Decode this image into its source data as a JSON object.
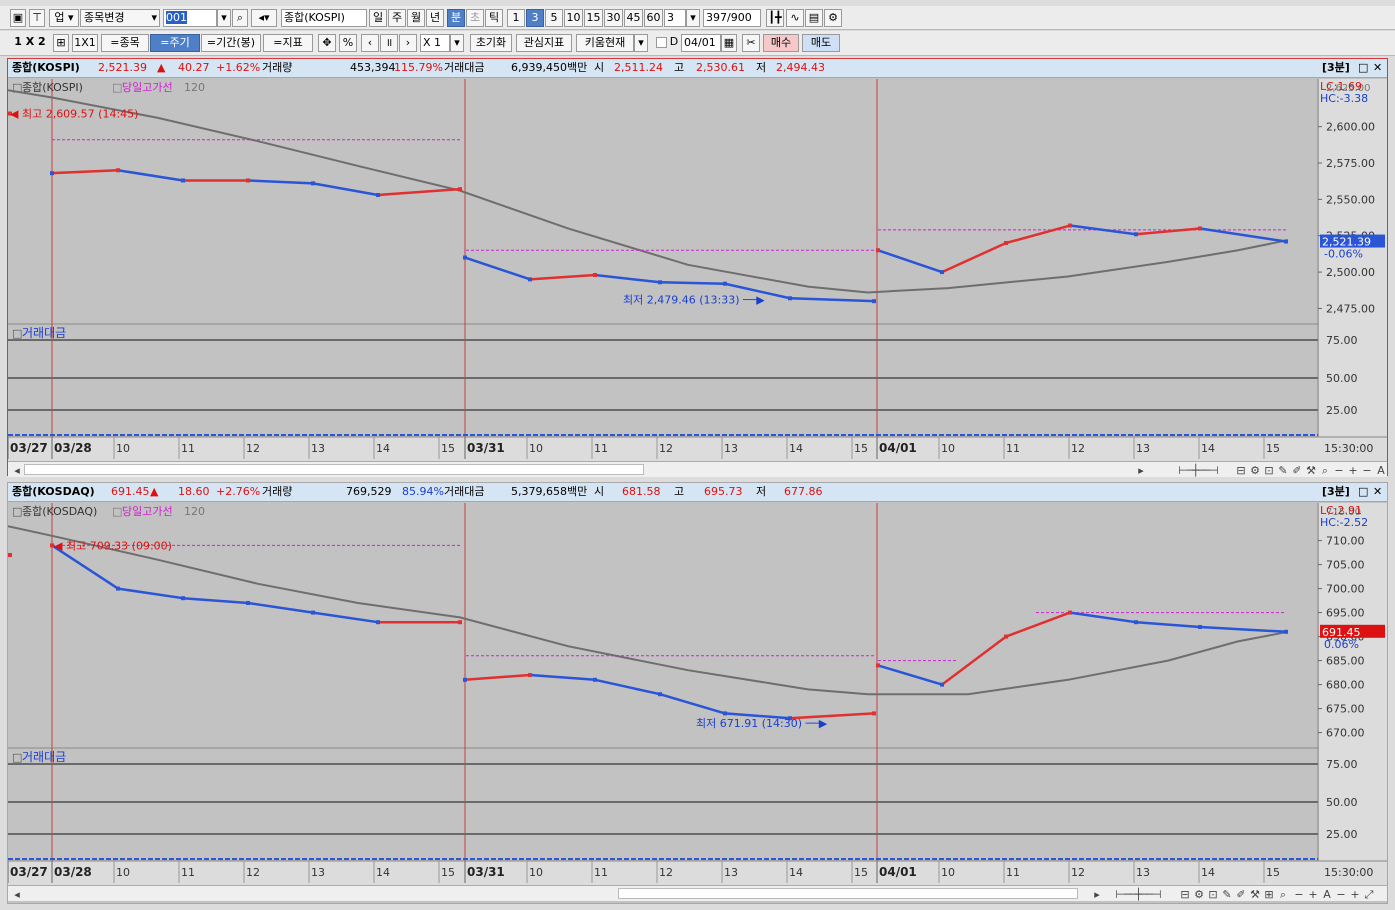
{
  "toolbar1": {
    "market": "업",
    "change_item": "종목변경",
    "code": "001",
    "name": "종합(KOSPI)",
    "periods": [
      "일",
      "주",
      "월",
      "년",
      "분",
      "초",
      "틱"
    ],
    "minutes": [
      "1",
      "3",
      "5",
      "10",
      "15",
      "30",
      "45",
      "60"
    ],
    "interval": "3",
    "count": "397",
    "count_max": "/900"
  },
  "toolbar2": {
    "layout_1x2": "1 X 2",
    "layout_1x1": "1X1",
    "item_btn": "=종목",
    "period_btn": "=주기",
    "range_btn": "=기간(봉)",
    "indicator_btn": "=지표",
    "percent": "%",
    "zoom": "X 1",
    "reset": "초기화",
    "interest": "관심지표",
    "kiwoom": "키움현재",
    "d_label": "D",
    "date": "04/01",
    "buy": "매수",
    "sell": "매도"
  },
  "panel1": {
    "title": "종합(KOSPI)",
    "price": "2,521.39",
    "change": "40.27",
    "change_pct": "+1.62%",
    "vol_label": "거래량",
    "vol": "453,394",
    "vol_pct": "115.79%",
    "amt_label": "거래대금",
    "amt": "6,939,450백만",
    "open_label": "시",
    "open": "2,511.24",
    "high_label": "고",
    "high": "2,530.61",
    "low_label": "저",
    "low": "2,494.43",
    "interval_tag": "[3분]",
    "legend_name": "종합(KOSPI)",
    "legend_hl": "당일고가선",
    "legend_ma": "120",
    "lc": "LC:1.69",
    "hc": "HC:-3.38",
    "axis_top": "2,625.00",
    "y_ticks": [
      "2,600.00",
      "2,575.00",
      "2,550.00",
      "2,525.00",
      "2,500.00",
      "2,475.00"
    ],
    "y_values": [
      2600,
      2575,
      2550,
      2525,
      2500,
      2475
    ],
    "current_label": "2,521.39",
    "current_pct": "-0.06%",
    "max_label": "최고 2,609.57 (14:45)",
    "min_label": "최저 2,479.46 (13:33)",
    "sub_label": "거래대금",
    "sub_ticks": [
      "75.00",
      "50.00",
      "25.00"
    ],
    "dates": [
      "03/27",
      "03/28",
      "03/31",
      "04/01"
    ],
    "hours_a": [
      "10",
      "11",
      "12",
      "13",
      "14",
      "15"
    ],
    "hours_b": [
      "10",
      "11",
      "12",
      "13",
      "14",
      "15"
    ],
    "hours_c": [
      "10",
      "11",
      "12",
      "13",
      "14",
      "15"
    ],
    "time_right": "15:30:00"
  },
  "panel2": {
    "title": "종합(KOSDAQ)",
    "price": "691.45",
    "change": "18.60",
    "change_pct": "+2.76%",
    "vol_label": "거래량",
    "vol": "769,529",
    "vol_pct": "85.94%",
    "amt_label": "거래대금",
    "amt": "5,379,658백만",
    "open_label": "시",
    "open": "681.58",
    "high_label": "고",
    "high": "695.73",
    "low_label": "저",
    "low": "677.86",
    "interval_tag": "[3분]",
    "legend_name": "종합(KOSDAQ)",
    "legend_hl": "당일고가선",
    "legend_ma": "120",
    "lc": "LC:2.91",
    "hc": "HC:-2.52",
    "axis_top": "715.00",
    "y_ticks": [
      "710.00",
      "705.00",
      "700.00",
      "695.00",
      "690.00",
      "685.00",
      "680.00",
      "675.00",
      "670.00"
    ],
    "y_values": [
      710,
      705,
      700,
      695,
      690,
      685,
      680,
      675,
      670
    ],
    "current_label": "691.45",
    "current_pct": "0.06%",
    "max_label": "최고 709.33 (09:00)",
    "min_label": "최저 671.91 (14:30)",
    "sub_label": "거래대금",
    "sub_ticks": [
      "75.00",
      "50.00",
      "25.00"
    ],
    "dates": [
      "03/27",
      "03/28",
      "03/31",
      "04/01"
    ],
    "hours_a": [
      "10",
      "11",
      "12",
      "13",
      "14",
      "15"
    ],
    "hours_b": [
      "10",
      "11",
      "12",
      "13",
      "14",
      "15"
    ],
    "hours_c": [
      "10",
      "11",
      "12",
      "13",
      "14",
      "15"
    ],
    "time_right": "15:30:00"
  },
  "colors": {
    "up": "#e03030",
    "down": "#2a55d6",
    "ma": "#6e6e6e",
    "highline": "#d020d0",
    "bg": "#c2c2c2",
    "divider": "#c84040"
  },
  "chart_data": [
    {
      "type": "line",
      "title": "종합(KOSPI)",
      "x": [
        "03/27 15:30",
        "03/28 09:00",
        "03/28 10:00",
        "03/28 11:00",
        "03/28 12:00",
        "03/28 13:00",
        "03/28 14:00",
        "03/28 15:30",
        "03/31 09:00",
        "03/31 10:00",
        "03/31 11:00",
        "03/31 12:00",
        "03/31 13:00",
        "03/31 14:00",
        "03/31 15:30",
        "04/01 09:00",
        "04/01 10:00",
        "04/01 11:00",
        "04/01 12:00",
        "04/01 13:00",
        "04/01 14:00",
        "04/01 15:30"
      ],
      "series": [
        {
          "values": [
            2609,
            2568,
            2570,
            2563,
            2563,
            2561,
            2553,
            2557,
            2510,
            2495,
            2498,
            2493,
            2492,
            2482,
            2480,
            2515,
            2500,
            2520,
            2532,
            2526,
            2530,
            2521
          ]
        }
      ],
      "ylim": [
        2465,
        2630
      ]
    },
    {
      "type": "line",
      "title": "종합(KOSDAQ)",
      "x": [
        "03/27 15:30",
        "03/28 09:00",
        "03/28 10:00",
        "03/28 11:00",
        "03/28 12:00",
        "03/28 13:00",
        "03/28 14:00",
        "03/28 15:30",
        "03/31 09:00",
        "03/31 10:00",
        "03/31 11:00",
        "03/31 12:00",
        "03/31 13:00",
        "03/31 14:00",
        "03/31 15:30",
        "04/01 09:00",
        "04/01 10:00",
        "04/01 11:00",
        "04/01 12:00",
        "04/01 13:00",
        "04/01 14:00",
        "04/01 15:30"
      ],
      "series": [
        {
          "values": [
            707,
            709,
            700,
            698,
            697,
            695,
            693,
            693,
            681,
            682,
            681,
            678,
            674,
            673,
            674,
            684,
            680,
            690,
            695,
            693,
            692,
            691
          ]
        }
      ],
      "ylim": [
        667,
        717
      ]
    }
  ]
}
